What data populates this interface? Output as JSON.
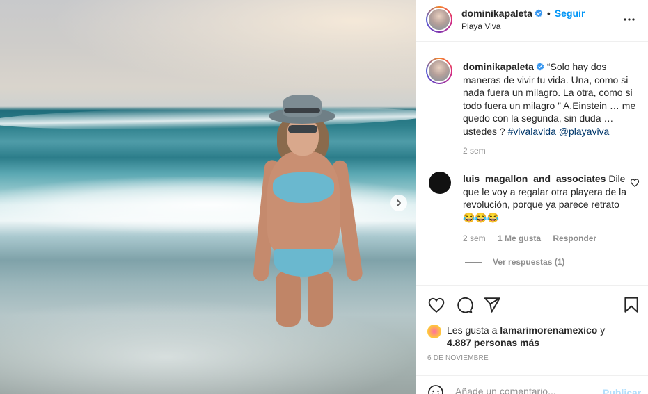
{
  "post": {
    "username": "dominikapaleta",
    "verified_icon": "verified-badge-icon",
    "follow_label": "Seguir",
    "separator": "•",
    "location": "Playa Viva",
    "more_icon": "more-options-icon"
  },
  "caption": {
    "username": "dominikapaleta",
    "text": "“Solo hay dos maneras de vivir tu vida. Una, como si nada fuera un milagro. La otra, como si todo fuera un milagro ” A.Einstein … me quedo con la segunda, sin duda … ustedes ? ",
    "hashtag": "#vivalavida",
    "mention": "@playaviva",
    "time": "2 sem"
  },
  "comment": {
    "username": "luis_magallon_and_associates",
    "text": " Dile que le voy a regalar otra playera de la revolución, porque ya parece retrato 😂😂😂",
    "time": "2 sem",
    "likes": "1 Me gusta",
    "reply_label": "Responder",
    "view_replies": "Ver respuestas (1)"
  },
  "likes": {
    "prefix": "Les gusta a ",
    "liker": "lamarimorenamexico",
    "suffix": " y",
    "count": "4.887 personas más"
  },
  "date": "6 DE NOVIEMBRE",
  "add_comment": {
    "placeholder": "Añade un comentario...",
    "publish_label": "Publicar"
  },
  "colors": {
    "accent": "#0095f6",
    "publish_disabled": "#b2dffc",
    "secondary_text": "#8e8e8e",
    "hashtag": "#00376b"
  }
}
